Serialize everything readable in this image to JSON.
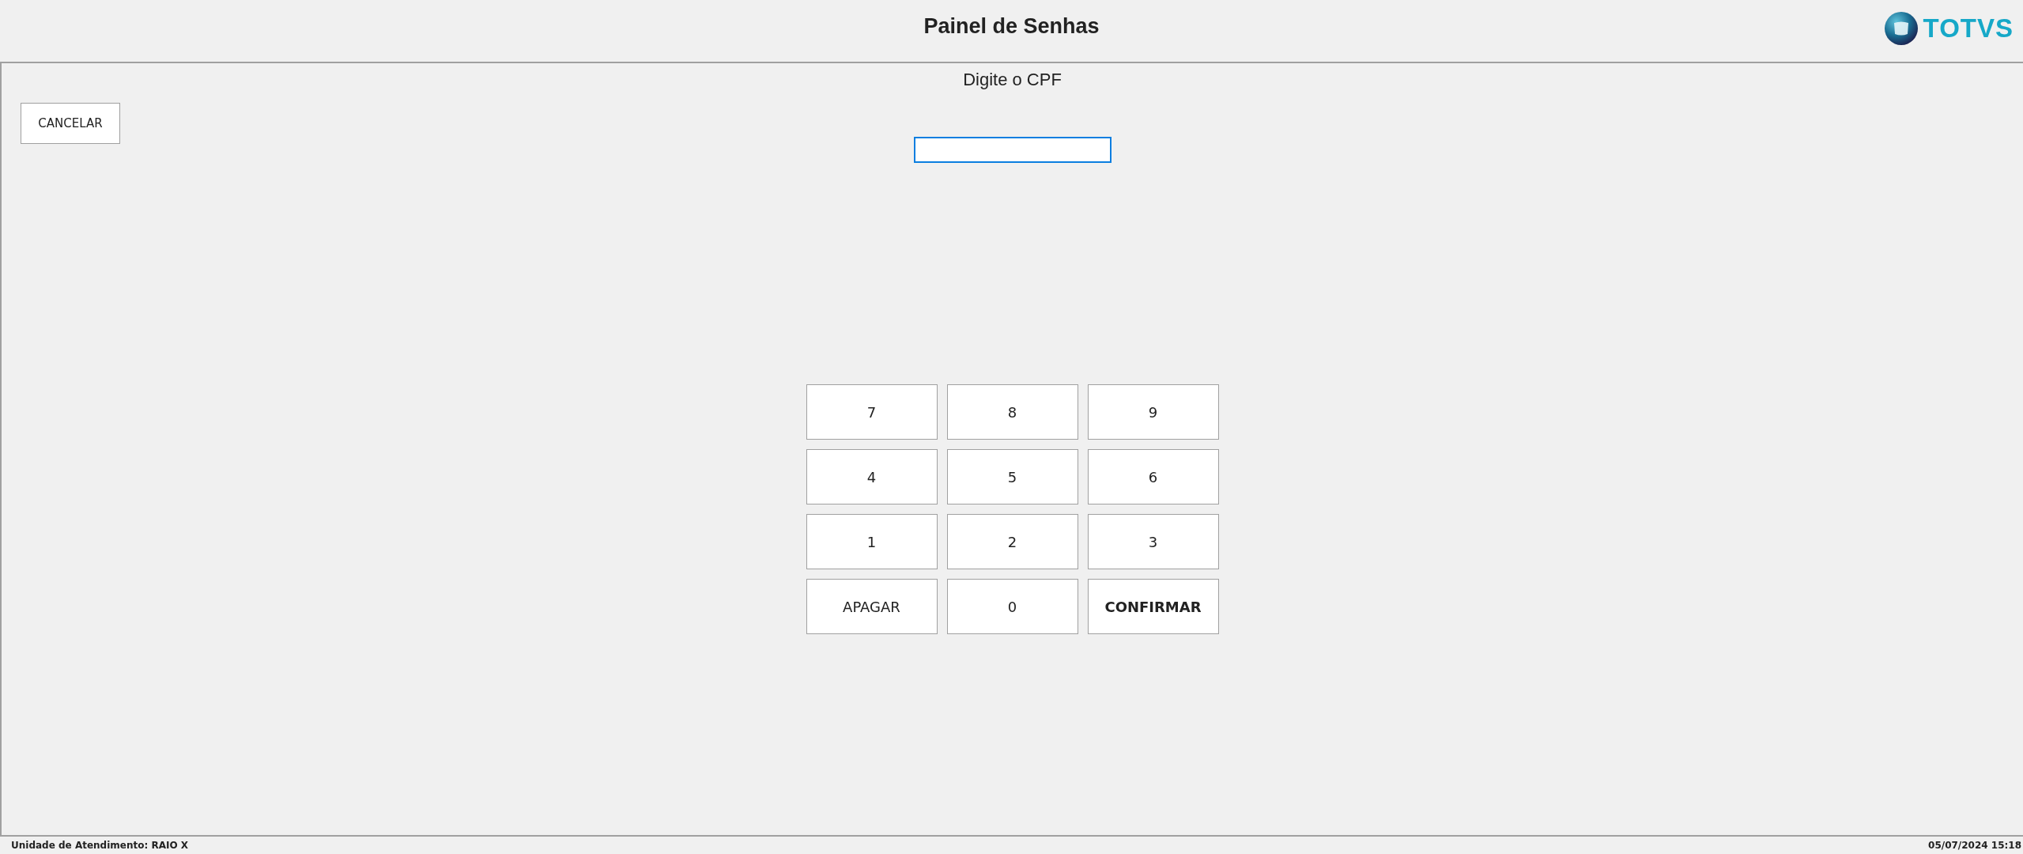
{
  "header": {
    "title": "Painel de Senhas",
    "logo_text": "TOTVS"
  },
  "panel": {
    "heading": "Digite o CPF",
    "cancel_button": "CANCELAR",
    "cpf_field": {
      "focused": true
    }
  },
  "keypad": [
    {
      "label": "7",
      "kind": "digit"
    },
    {
      "label": "8",
      "kind": "digit"
    },
    {
      "label": "9",
      "kind": "digit"
    },
    {
      "label": "4",
      "kind": "digit"
    },
    {
      "label": "5",
      "kind": "digit"
    },
    {
      "label": "6",
      "kind": "digit"
    },
    {
      "label": "1",
      "kind": "digit"
    },
    {
      "label": "2",
      "kind": "digit"
    },
    {
      "label": "3",
      "kind": "digit"
    },
    {
      "label": "APAGAR",
      "kind": "erase"
    },
    {
      "label": "0",
      "kind": "digit"
    },
    {
      "label": "CONFIRMAR",
      "kind": "confirm"
    }
  ],
  "status_bar": {
    "unit": "Unidade de Atendimento: RAIO X",
    "datetime": "05/07/2024 15:18"
  }
}
